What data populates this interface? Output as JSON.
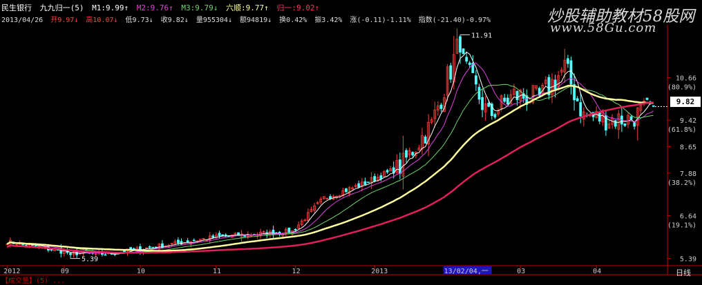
{
  "header": {
    "stock_name": "民生银行",
    "indicator": "九九归一(5)",
    "m1": "M1:9.99↑",
    "m2": "M2:9.76↑",
    "m3": "M3:9.79↓",
    "six_smooth": "六顺:9.77↑",
    "return_one": "归一:9.02↑"
  },
  "info": {
    "date": "2013/04/26",
    "open": "开9.97↓",
    "high": "高10.07↓",
    "low": "低9.73↓",
    "close": "收9.82↓",
    "volume": "量955304↓",
    "amount": "额94819↓",
    "turnover": "换0.42%",
    "amplitude": "振3.42%",
    "change": "涨(-0.11)-1.11%",
    "index": "指数(-21.40)-0.97%"
  },
  "watermark": {
    "line1": "炒股辅助教材58股网",
    "line2": "www.58Gu.com"
  },
  "current_price": "9.82",
  "period_label": "日线",
  "colors": {
    "up_candle": "#ff3b3b",
    "down_candle": "#54ffff",
    "m1": "#ffffff",
    "m2": "#e040e0",
    "m3": "#6fd66f",
    "six_smooth": "#ffffa0",
    "return_one": "#e0205a",
    "axis": "#c00000"
  },
  "bottom_text": "【成交量】(5) ...",
  "chart_data": {
    "type": "candlestick",
    "title": "",
    "ylim": [
      5.2,
      12.2
    ],
    "right_axis": [
      {
        "value": 10.66,
        "label": "10.66",
        "pct": "(80.9%)"
      },
      {
        "value": 9.42,
        "label": "9.42",
        "pct": "(61.8%)"
      },
      {
        "value": 8.65,
        "label": "8.65",
        "pct": ""
      },
      {
        "value": 7.88,
        "label": "7.88",
        "pct": "(38.2%)"
      },
      {
        "value": 6.64,
        "label": "6.64",
        "pct": "(19.1%)"
      },
      {
        "value": 5.39,
        "label": "5.39",
        "pct": ""
      }
    ],
    "x_ticks": [
      {
        "index": 0,
        "label": "2012"
      },
      {
        "index": 18,
        "label": "09"
      },
      {
        "index": 42,
        "label": "10"
      },
      {
        "index": 66,
        "label": "11"
      },
      {
        "index": 91,
        "label": "12"
      },
      {
        "index": 116,
        "label": "2013"
      },
      {
        "index": 139,
        "label": "13/02/04,一",
        "highlight": true
      },
      {
        "index": 162,
        "label": "03"
      },
      {
        "index": 186,
        "label": "04"
      }
    ],
    "annotations": [
      {
        "label": "11.91",
        "value": 11.91,
        "index": 143
      },
      {
        "label": "5.39",
        "value": 5.39,
        "index": 20
      }
    ],
    "anchors": [
      {
        "i": 0,
        "p": 5.88
      },
      {
        "i": 20,
        "p": 5.55
      },
      {
        "i": 32,
        "p": 5.52
      },
      {
        "i": 48,
        "p": 5.75
      },
      {
        "i": 66,
        "p": 6.02
      },
      {
        "i": 90,
        "p": 6.18
      },
      {
        "i": 100,
        "p": 7.15
      },
      {
        "i": 112,
        "p": 7.55
      },
      {
        "i": 124,
        "p": 8.05
      },
      {
        "i": 134,
        "p": 9.3
      },
      {
        "i": 142,
        "p": 11.45
      },
      {
        "i": 147,
        "p": 10.45
      },
      {
        "i": 152,
        "p": 9.55
      },
      {
        "i": 160,
        "p": 10.15
      },
      {
        "i": 168,
        "p": 10.05
      },
      {
        "i": 176,
        "p": 10.95
      },
      {
        "i": 182,
        "p": 9.55
      },
      {
        "i": 190,
        "p": 9.45
      },
      {
        "i": 196,
        "p": 9.45
      },
      {
        "i": 204,
        "p": 9.82
      }
    ],
    "total_bars": 205
  }
}
